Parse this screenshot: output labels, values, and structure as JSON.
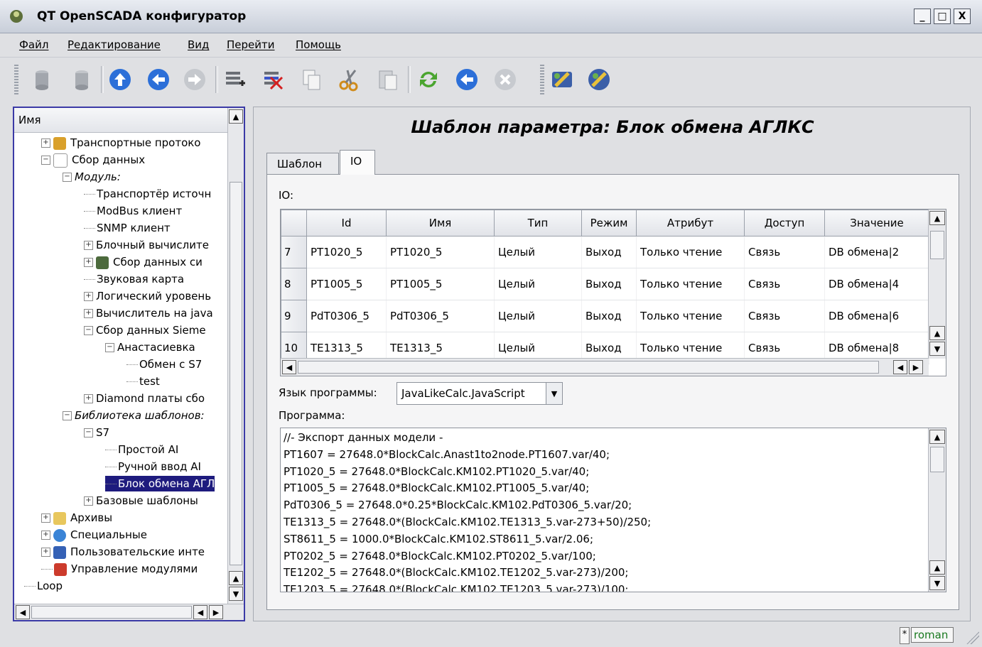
{
  "window": {
    "title": "QT OpenSCADA конфигуратор",
    "min": "_",
    "max": "□",
    "close": "X"
  },
  "menubar": [
    "Файл",
    "Редактирование",
    "Вид",
    "Перейти",
    "Помощь"
  ],
  "toolbar": {
    "icons": [
      "db-load-icon",
      "db-save-icon",
      "up-arrow-icon",
      "back-arrow-icon",
      "forward-arrow-icon",
      "add-item-icon",
      "delete-item-icon",
      "copy-icon",
      "cut-icon",
      "paste-icon",
      "refresh-icon",
      "start-icon",
      "stop-icon",
      "module-config-icon",
      "module-config2-icon"
    ]
  },
  "tree": {
    "header": "Имя",
    "items": [
      {
        "level": 1,
        "label": "Транспортные протоко",
        "expander": "+",
        "icon": "transport-icon",
        "italic": false,
        "selected": false
      },
      {
        "level": 1,
        "label": "Сбор данных",
        "expander": "-",
        "icon": "chart-icon",
        "italic": false,
        "selected": false
      },
      {
        "level": 2,
        "label": "Модуль:",
        "expander": "-",
        "icon": "",
        "italic": true,
        "selected": false
      },
      {
        "level": 3,
        "label": "Транспортёр источн",
        "expander": "",
        "icon": "",
        "italic": false,
        "selected": false
      },
      {
        "level": 3,
        "label": "ModBus клиент",
        "expander": "",
        "icon": "",
        "italic": false,
        "selected": false
      },
      {
        "level": 3,
        "label": "SNMP клиент",
        "expander": "",
        "icon": "",
        "italic": false,
        "selected": false
      },
      {
        "level": 3,
        "label": "Блочный вычислите",
        "expander": "+",
        "icon": "",
        "italic": false,
        "selected": false
      },
      {
        "level": 3,
        "label": "Сбор данных си",
        "expander": "+",
        "icon": "tools-icon",
        "italic": false,
        "selected": false
      },
      {
        "level": 3,
        "label": "Звуковая карта",
        "expander": "",
        "icon": "",
        "italic": false,
        "selected": false
      },
      {
        "level": 3,
        "label": "Логический уровень",
        "expander": "+",
        "icon": "",
        "italic": false,
        "selected": false
      },
      {
        "level": 3,
        "label": "Вычислитель на java",
        "expander": "+",
        "icon": "",
        "italic": false,
        "selected": false
      },
      {
        "level": 3,
        "label": "Сбор данных Sieme",
        "expander": "-",
        "icon": "",
        "italic": false,
        "selected": false
      },
      {
        "level": 4,
        "label": "Анастасиевка",
        "expander": "-",
        "icon": "",
        "italic": false,
        "selected": false
      },
      {
        "level": 5,
        "label": "Обмен с S7",
        "expander": "",
        "icon": "",
        "italic": false,
        "selected": false
      },
      {
        "level": 5,
        "label": "test",
        "expander": "",
        "icon": "",
        "italic": false,
        "selected": false
      },
      {
        "level": 3,
        "label": "Diamond платы сбо",
        "expander": "+",
        "icon": "",
        "italic": false,
        "selected": false
      },
      {
        "level": 2,
        "label": "Библиотека шаблонов:",
        "expander": "-",
        "icon": "",
        "italic": true,
        "selected": false
      },
      {
        "level": 3,
        "label": "S7",
        "expander": "-",
        "icon": "",
        "italic": false,
        "selected": false
      },
      {
        "level": 4,
        "label": "Простой AI",
        "expander": "",
        "icon": "",
        "italic": false,
        "selected": false
      },
      {
        "level": 4,
        "label": "Ручной ввод AI",
        "expander": "",
        "icon": "",
        "italic": false,
        "selected": false
      },
      {
        "level": 4,
        "label": "Блок обмена АГЛ",
        "expander": "",
        "icon": "",
        "italic": false,
        "selected": true
      },
      {
        "level": 3,
        "label": "Базовые шаблоны",
        "expander": "+",
        "icon": "",
        "italic": false,
        "selected": false
      },
      {
        "level": 1,
        "label": "Архивы",
        "expander": "+",
        "icon": "archive-icon",
        "italic": false,
        "selected": false
      },
      {
        "level": 1,
        "label": "Специальные",
        "expander": "+",
        "icon": "help-icon",
        "italic": false,
        "selected": false
      },
      {
        "level": 1,
        "label": "Пользовательские инте",
        "expander": "+",
        "icon": "monitor-icon",
        "italic": false,
        "selected": false
      },
      {
        "level": 1,
        "label": "Управление модулями",
        "expander": "",
        "icon": "modules-icon",
        "italic": false,
        "selected": false
      },
      {
        "level": 0,
        "label": "Loop",
        "expander": "",
        "icon": "",
        "italic": false,
        "selected": false
      }
    ]
  },
  "main": {
    "title": "Шаблон параметра: Блок обмена АГЛКС",
    "tabs": [
      "Шаблон",
      "IO"
    ],
    "active_tab": "IO",
    "io_label": "IO:",
    "io_table": {
      "columns": [
        "",
        "Id",
        "Имя",
        "Тип",
        "Режим",
        "Атрибут",
        "Доступ",
        "Значение"
      ],
      "rows": [
        [
          "7",
          "PT1020_5",
          "PT1020_5",
          "Целый",
          "Выход",
          "Только чтение",
          "Связь",
          "DB обмена|2"
        ],
        [
          "8",
          "PT1005_5",
          "PT1005_5",
          "Целый",
          "Выход",
          "Только чтение",
          "Связь",
          "DB обмена|4"
        ],
        [
          "9",
          "PdT0306_5",
          "PdT0306_5",
          "Целый",
          "Выход",
          "Только чтение",
          "Связь",
          "DB обмена|6"
        ],
        [
          "10",
          "TE1313_5",
          "TE1313_5",
          "Целый",
          "Выход",
          "Только чтение",
          "Связь",
          "DB обмена|8"
        ]
      ]
    },
    "lang_label": "Язык программы:",
    "lang_value": "JavaLikeCalc.JavaScript",
    "program_label": "Программа:",
    "program_lines": [
      "//- Экспорт данных модели -",
      "PT1607 = 27648.0*BlockCalc.Anast1to2node.PT1607.var/40;",
      "PT1020_5 = 27648.0*BlockCalc.KM102.PT1020_5.var/40;",
      "PT1005_5 = 27648.0*BlockCalc.KM102.PT1005_5.var/40;",
      "PdT0306_5 = 27648.0*0.25*BlockCalc.KM102.PdT0306_5.var/20;",
      "TE1313_5 = 27648.0*(BlockCalc.KM102.TE1313_5.var-273+50)/250;",
      "ST8611_5 = 1000.0*BlockCalc.KM102.ST8611_5.var/2.06;",
      "PT0202_5 = 27648.0*BlockCalc.KM102.PT0202_5.var/100;",
      "TE1202_5 = 27648.0*(BlockCalc.KM102.TE1202_5.var-273)/200;",
      "TE1203_5 = 27648.0*(BlockCalc.KM102.TE1203_5.var-273)/100;"
    ]
  },
  "status": {
    "modified": "*",
    "user": "roman"
  }
}
